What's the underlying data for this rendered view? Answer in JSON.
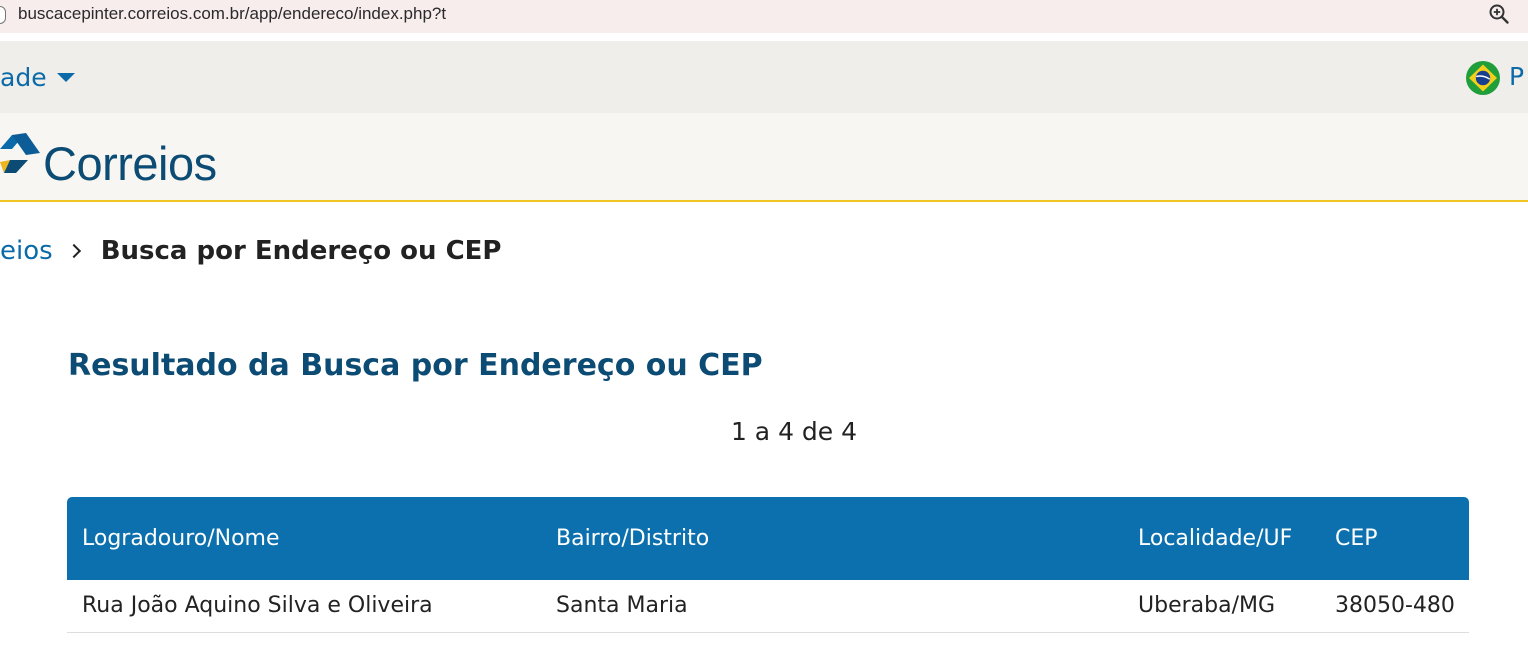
{
  "browser": {
    "url": "buscacepinter.correios.com.br/app/endereco/index.php?t",
    "zoom_icon": "zoom-in-icon"
  },
  "topbar": {
    "accessibility_label": "ade",
    "language_label": "P"
  },
  "logo": {
    "text": "Correios"
  },
  "breadcrumb": {
    "home_label": "eios",
    "current_label": "Busca por Endereço ou CEP"
  },
  "result": {
    "title": "Resultado da Busca por Endereço ou CEP",
    "pager": "1 a 4 de 4"
  },
  "table": {
    "headers": [
      "Logradouro/Nome",
      "Bairro/Distrito",
      "Localidade/UF",
      "CEP"
    ],
    "rows": [
      [
        "Rua João Aquino Silva e Oliveira",
        "Santa Maria",
        "Uberaba/MG",
        "38050-480"
      ]
    ]
  },
  "colors": {
    "header_bg": "#0b70ad",
    "brand_blue": "#0c4b74",
    "link_blue": "#0b6aa8",
    "accent_yellow": "#f0c425"
  }
}
